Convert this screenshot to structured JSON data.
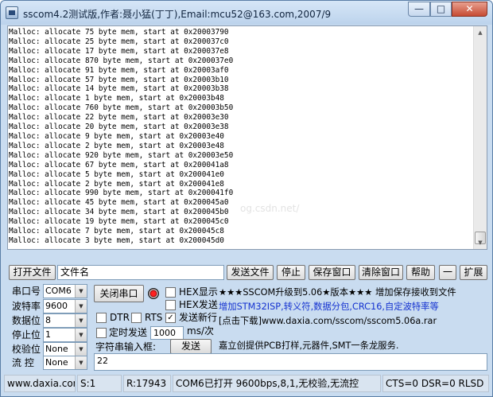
{
  "window": {
    "title": "sscom4.2测试版,作者:聂小猛(丁丁),Email:mcu52@163.com,2007/9",
    "min_label": "—",
    "max_label": "□",
    "close_label": "✕"
  },
  "output": {
    "lines": [
      "Malloc: allocate 75 byte mem, start at 0x20003790",
      "Malloc: allocate 25 byte mem, start at 0x200037c0",
      "Malloc: allocate 17 byte mem, start at 0x200037e8",
      "Malloc: allocate 870 byte mem, start at 0x200037e0",
      "Malloc: allocate 91 byte mem, start at 0x20003af0",
      "Malloc: allocate 57 byte mem, start at 0x20003b10",
      "Malloc: allocate 14 byte mem, start at 0x20003b38",
      "Malloc: allocate 1 byte mem, start at 0x20003b48",
      "Malloc: allocate 760 byte mem, start at 0x20003b50",
      "Malloc: allocate 22 byte mem, start at 0x20003e30",
      "Malloc: allocate 20 byte mem, start at 0x20003e38",
      "Malloc: allocate 9 byte mem, start at 0x20003e40",
      "Malloc: allocate 2 byte mem, start at 0x20003e48",
      "Malloc: allocate 920 byte mem, start at 0x20003e50",
      "Malloc: allocate 67 byte mem, start at 0x200041a8",
      "Malloc: allocate 5 byte mem, start at 0x200041e0",
      "Malloc: allocate 2 byte mem, start at 0x200041e8",
      "Malloc: allocate 990 byte mem, start at 0x200041f0",
      "Malloc: allocate 45 byte mem, start at 0x200045a0",
      "Malloc: allocate 34 byte mem, start at 0x200045b0",
      "Malloc: allocate 19 byte mem, start at 0x200045c0",
      "Malloc: allocate 7 byte mem, start at 0x200045c8",
      "Malloc: allocate 3 byte mem, start at 0x200045d0"
    ],
    "watermark": "og.csdn.net/"
  },
  "toolbar": {
    "open_file": "打开文件",
    "filename": "文件名",
    "send_file": "发送文件",
    "stop": "停止",
    "save_window": "保存窗口",
    "clear_window": "清除窗口",
    "help": "帮助",
    "collapse": "一",
    "expand": "扩展"
  },
  "settings": {
    "port_label": "串口号",
    "port_value": "COM6",
    "baud_label": "波特率",
    "baud_value": "9600",
    "data_bits_label": "数据位",
    "data_bits_value": "8",
    "stop_bits_label": "停止位",
    "stop_bits_value": "1",
    "parity_label": "校验位",
    "parity_value": "None",
    "flow_label": "流 控",
    "flow_value": "None"
  },
  "controls": {
    "close_port": "关闭串口",
    "hex_display": "HEX显示",
    "hex_send": "HEX发送",
    "dtr": "DTR",
    "rts": "RTS",
    "send_newline": "发送新行",
    "send_newline_checked": "✓",
    "timed_send": "定时发送",
    "interval_value": "1000",
    "interval_unit": "ms/次",
    "string_input_label": "字符串输入框:",
    "send": "发送",
    "send_text": "22"
  },
  "ads": {
    "line1": "★★★SSCOM升级到5.06★版本★★★  增加保存接收到文件",
    "line2": "增加STM32ISP,转义符,数据分包,CRC16,自定波特率等",
    "line3": "[点击下载]www.daxia.com/sscom/sscom5.06a.rar",
    "line4": "嘉立创提供PCB打样,元器件,SMT一条龙服务."
  },
  "status": {
    "website": "www.daxia.com",
    "sent": "S:1",
    "received": "R:17943",
    "port_state": "COM6已打开  9600bps,8,1,无校验,无流控",
    "lines": "CTS=0 DSR=0 RLSD"
  }
}
